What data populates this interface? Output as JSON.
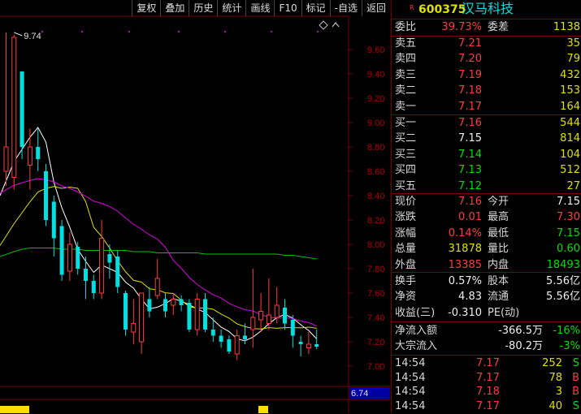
{
  "toolbar": {
    "buttons": [
      "复权",
      "叠加",
      "历史",
      "统计",
      "画线",
      "F10",
      "标记",
      "-自选",
      "返回"
    ]
  },
  "chart": {
    "price_ticks": [
      "9.60",
      "9.40",
      "9.20",
      "9.00",
      "8.80",
      "8.60",
      "8.40",
      "8.20",
      "8.00",
      "7.80",
      "7.60",
      "7.40",
      "7.20",
      "7.00"
    ],
    "high_marker": "9.74",
    "low_marker": "6.74",
    "colors": {
      "up": "#ff3c3c",
      "down": "#00e0e0",
      "ma5": "#ffffff",
      "ma10": "#e0e000",
      "ma20": "#e000e0",
      "ma60": "#00c000"
    }
  },
  "chart_data": {
    "type": "candlestick",
    "ylim": [
      6.98,
      9.82
    ],
    "candles": [
      {
        "o": 8.6,
        "c": 8.8,
        "h": 9.74,
        "l": 8.48
      },
      {
        "o": 8.55,
        "c": 9.7,
        "h": 9.72,
        "l": 8.45
      },
      {
        "o": 9.42,
        "c": 8.8,
        "h": 9.42,
        "l": 8.7
      },
      {
        "o": 8.65,
        "c": 8.8,
        "h": 8.95,
        "l": 8.45
      },
      {
        "o": 8.8,
        "c": 8.7,
        "h": 8.95,
        "l": 8.6
      },
      {
        "o": 8.6,
        "c": 8.2,
        "h": 8.66,
        "l": 8.15
      },
      {
        "o": 8.35,
        "c": 8.05,
        "h": 8.4,
        "l": 7.9
      },
      {
        "o": 8.15,
        "c": 7.75,
        "h": 8.2,
        "l": 7.7
      },
      {
        "o": 7.78,
        "c": 8.0,
        "h": 8.1,
        "l": 7.7
      },
      {
        "o": 7.98,
        "c": 7.8,
        "h": 8.02,
        "l": 7.75
      },
      {
        "o": 7.8,
        "c": 7.7,
        "h": 7.9,
        "l": 7.55
      },
      {
        "o": 7.7,
        "c": 7.6,
        "h": 7.75,
        "l": 7.55
      },
      {
        "o": 7.6,
        "c": 8.05,
        "h": 8.2,
        "l": 7.55
      },
      {
        "o": 7.92,
        "c": 7.85,
        "h": 8.0,
        "l": 7.72
      },
      {
        "o": 7.9,
        "c": 7.65,
        "h": 7.95,
        "l": 7.6
      },
      {
        "o": 7.6,
        "c": 7.3,
        "h": 7.62,
        "l": 7.25
      },
      {
        "o": 7.28,
        "c": 7.35,
        "h": 7.55,
        "l": 7.18
      },
      {
        "o": 7.2,
        "c": 7.6,
        "h": 7.6,
        "l": 7.1
      },
      {
        "o": 7.55,
        "c": 7.45,
        "h": 7.65,
        "l": 7.4
      },
      {
        "o": 7.58,
        "c": 7.72,
        "h": 7.88,
        "l": 7.55
      },
      {
        "o": 7.55,
        "c": 7.45,
        "h": 7.6,
        "l": 7.4
      },
      {
        "o": 7.5,
        "c": 7.55,
        "h": 7.6,
        "l": 7.42
      },
      {
        "o": 7.55,
        "c": 7.5,
        "h": 7.58,
        "l": 7.45
      },
      {
        "o": 7.52,
        "c": 7.3,
        "h": 7.55,
        "l": 7.28
      },
      {
        "o": 7.3,
        "c": 7.55,
        "h": 7.6,
        "l": 7.25
      },
      {
        "o": 7.55,
        "c": 7.3,
        "h": 7.6,
        "l": 7.28
      },
      {
        "o": 7.3,
        "c": 7.25,
        "h": 7.4,
        "l": 7.2
      },
      {
        "o": 7.25,
        "c": 7.2,
        "h": 7.3,
        "l": 7.15
      },
      {
        "o": 7.22,
        "c": 7.12,
        "h": 7.25,
        "l": 7.1
      },
      {
        "o": 7.1,
        "c": 7.25,
        "h": 7.3,
        "l": 7.05
      },
      {
        "o": 7.25,
        "c": 7.22,
        "h": 7.35,
        "l": 7.18
      },
      {
        "o": 7.3,
        "c": 7.4,
        "h": 7.8,
        "l": 7.15
      },
      {
        "o": 7.38,
        "c": 7.45,
        "h": 7.6,
        "l": 7.28
      },
      {
        "o": 7.35,
        "c": 7.42,
        "h": 7.72,
        "l": 7.3
      },
      {
        "o": 7.4,
        "c": 7.5,
        "h": 7.65,
        "l": 7.35
      },
      {
        "o": 7.48,
        "c": 7.35,
        "h": 7.55,
        "l": 7.3
      },
      {
        "o": 7.38,
        "c": 7.25,
        "h": 7.42,
        "l": 7.15
      },
      {
        "o": 7.2,
        "c": 7.18,
        "h": 7.25,
        "l": 7.08
      },
      {
        "o": 7.15,
        "c": 7.18,
        "h": 7.28,
        "l": 7.1
      },
      {
        "o": 7.18,
        "c": 7.16,
        "h": 7.3,
        "l": 7.14
      }
    ]
  },
  "stock": {
    "code": "600375",
    "name": "汉马科技"
  },
  "order_book": {
    "webi": {
      "label": "委比",
      "value": "39.73%",
      "label2": "委差",
      "value2": "1138"
    },
    "asks": [
      {
        "label": "卖五",
        "price": "7.21",
        "vol": "35"
      },
      {
        "label": "卖四",
        "price": "7.20",
        "vol": "79"
      },
      {
        "label": "卖三",
        "price": "7.19",
        "vol": "432"
      },
      {
        "label": "卖二",
        "price": "7.18",
        "vol": "153"
      },
      {
        "label": "卖一",
        "price": "7.17",
        "vol": "164"
      }
    ],
    "bids": [
      {
        "label": "买一",
        "price": "7.16",
        "vol": "544"
      },
      {
        "label": "买二",
        "price": "7.15",
        "vol": "814"
      },
      {
        "label": "买三",
        "price": "7.14",
        "vol": "104"
      },
      {
        "label": "买四",
        "price": "7.13",
        "vol": "512"
      },
      {
        "label": "买五",
        "price": "7.12",
        "vol": "27"
      }
    ]
  },
  "quote": [
    {
      "l1": "现价",
      "v1": "7.16",
      "l2": "今开",
      "v2": "7.15"
    },
    {
      "l1": "涨跌",
      "v1": "0.01",
      "l2": "最高",
      "v2": "7.30"
    },
    {
      "l1": "涨幅",
      "v1": "0.14%",
      "l2": "最低",
      "v2": "7.15"
    },
    {
      "l1": "总量",
      "v1": "31878",
      "l2": "量比",
      "v2": "0.60"
    },
    {
      "l1": "外盘",
      "v1": "13385",
      "l2": "内盘",
      "v2": "18493"
    }
  ],
  "fundamentals": [
    {
      "l1": "换手",
      "v1": "0.57%",
      "l2": "股本",
      "v2": "5.56亿"
    },
    {
      "l1": "净资",
      "v1": "4.83",
      "l2": "流通",
      "v2": "5.56亿"
    },
    {
      "l1": "收益(三)",
      "v1": "-0.310",
      "l2": "PE(动)",
      "v2": ""
    }
  ],
  "flows": [
    {
      "label": "净流入额",
      "value": "-366.5万",
      "pct": "-16%"
    },
    {
      "label": "大宗流入",
      "value": "-80.2万",
      "pct": "-3%"
    }
  ],
  "ticks": [
    {
      "time": "14:54",
      "price": "7.17",
      "vol": "252",
      "side": "S"
    },
    {
      "time": "14:54",
      "price": "7.17",
      "vol": "78",
      "side": "B"
    },
    {
      "time": "14:54",
      "price": "7.18",
      "vol": "3",
      "side": "B"
    },
    {
      "time": "14:54",
      "price": "7.17",
      "vol": "40",
      "side": "S"
    }
  ]
}
